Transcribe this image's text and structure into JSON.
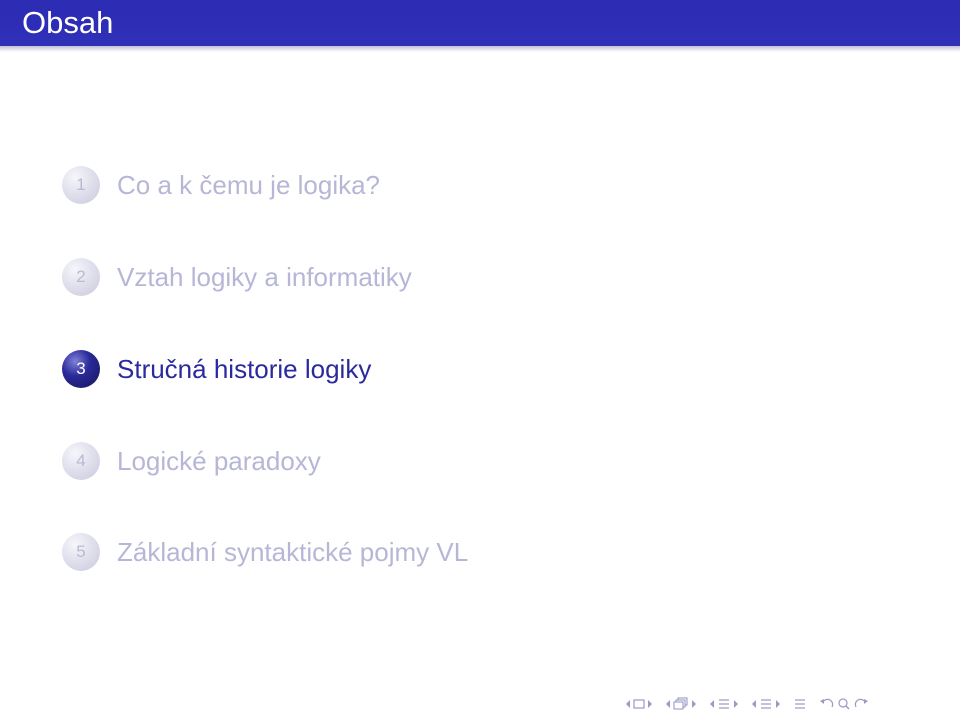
{
  "frame": {
    "title": "Obsah"
  },
  "toc": {
    "items": [
      {
        "number": "1",
        "label": "Co a k čemu je logika?",
        "state": "dim"
      },
      {
        "number": "2",
        "label": "Vztah logiky a informatiky",
        "state": "dim"
      },
      {
        "number": "3",
        "label": "Stručná historie logiky",
        "state": "active"
      },
      {
        "number": "4",
        "label": "Logické paradoxy",
        "state": "dim"
      },
      {
        "number": "5",
        "label": "Základní syntaktické pojmy VL",
        "state": "dim"
      }
    ]
  },
  "navigation": {
    "icons": [
      "prev-slide-icon",
      "slide-icon",
      "next-slide-icon",
      "prev-frame-icon",
      "frame-icon",
      "next-frame-icon",
      "prev-subsection-icon",
      "subsection-icon",
      "next-subsection-icon",
      "prev-section-icon",
      "section-icon",
      "next-section-icon",
      "align-icon",
      "back-icon",
      "search-icon",
      "forward-icon"
    ]
  },
  "colors": {
    "header_bg": "#2d2db7",
    "title_text": "#ffffff",
    "active_text": "#2a2a9e",
    "dim_text": "#b6b6d6",
    "nav_icon": "#9a9ac8"
  }
}
